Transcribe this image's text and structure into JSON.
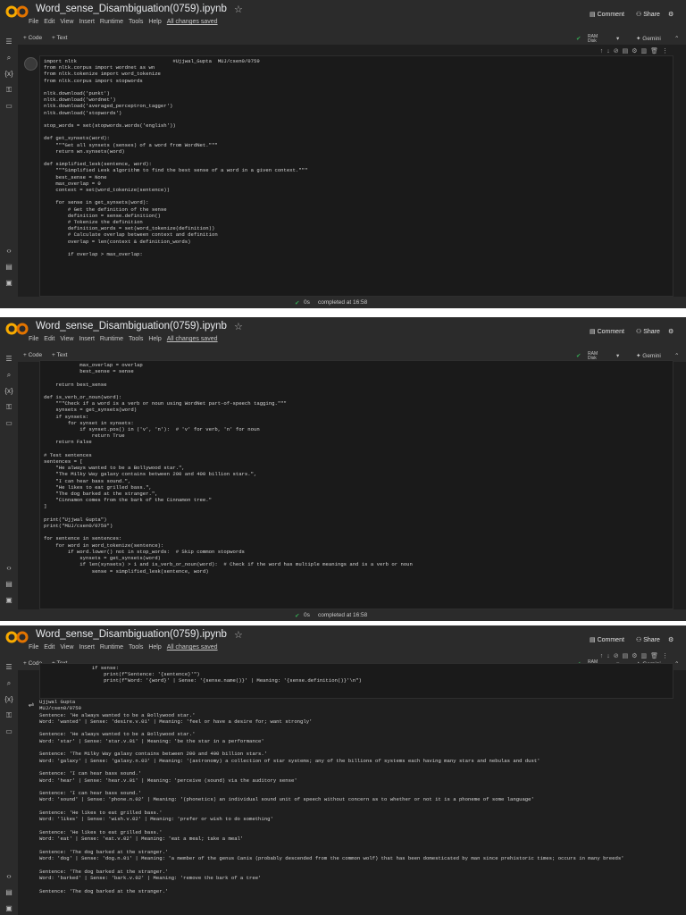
{
  "notebook": {
    "title": "Word_sense_Disambiguation(0759).ipynb",
    "menus": [
      "File",
      "Edit",
      "View",
      "Insert",
      "Runtime",
      "Tools",
      "Help"
    ],
    "saved_status": "All changes saved",
    "comment_label": "Comment",
    "share_label": "Share",
    "toolbar_code": "+ Code",
    "toolbar_text": "+ Text",
    "ram_label": "RAM",
    "disk_label": "Disk",
    "gemini_label": "Gemini",
    "status_time": "0s",
    "status_text": "completed at 16:58"
  },
  "cells": {
    "cell1_code": "import nltk                                #Ujjwal_Gupta  MUJ/csen0/0759\nfrom nltk.corpus import wordnet as wn\nfrom nltk.tokenize import word_tokenize\nfrom nltk.corpus import stopwords\n\nnltk.download('punkt')\nnltk.download('wordnet')\nnltk.download('averaged_perceptron_tagger')\nnltk.download('stopwords')\n\nstop_words = set(stopwords.words('english'))\n\ndef get_synsets(word):\n    \"\"\"Get all synsets (senses) of a word from WordNet.\"\"\"\n    return wn.synsets(word)\n\ndef simplified_lesk(sentence, word):\n    \"\"\"Simplified Lesk algorithm to find the best sense of a word in a given context.\"\"\"\n    best_sense = None\n    max_overlap = 0\n    context = set(word_tokenize(sentence))\n\n    for sense in get_synsets(word):\n        # Get the definition of the sense\n        definition = sense.definition()\n        # Tokenize the definition\n        definition_words = set(word_tokenize(definition))\n        # Calculate overlap between context and definition\n        overlap = len(context & definition_words)\n\n        if overlap > max_overlap:",
    "cell2_code": "            max_overlap = overlap\n            best_sense = sense\n\n    return best_sense\n\ndef is_verb_or_noun(word):\n    \"\"\"Check if a word is a verb or noun using WordNet part-of-speech tagging.\"\"\"\n    synsets = get_synsets(word)\n    if synsets:\n        for synset in synsets:\n            if synset.pos() in ('v', 'n'):  # 'v' for verb, 'n' for noun\n                return True\n    return False\n\n# Test sentences\nsentences = [\n    \"He always wanted to be a Bollywood star.\",\n    \"The Milky Way galaxy contains between 200 and 400 billion stars.\",\n    \"I can hear bass sound.\",\n    \"He likes to eat grilled bass.\",\n    \"The dog barked at the stranger.\",\n    \"Cinnamon comes from the bark of the Cinnamon tree.\"\n]\n\nprint(\"Ujjwal Gupta\")\nprint(\"MUJ/csen0/0759\")\n\nfor sentence in sentences:\n    for word in word_tokenize(sentence):\n        if word.lower() not in stop_words:  # Skip common stopwords\n            synsets = get_synsets(word)\n            if len(synsets) > 1 and is_verb_or_noun(word):  # Check if the word has multiple meanings and is a verb or noun\n                sense = simplified_lesk(sentence, word)",
    "cell3_code": "                if sense:\n                    print(f\"Sentence: '{sentence}'\")\n                    print(f\"Word: '{word}' | Sense: '{sense.name()}' | Meaning: '{sense.definition()}'\\n\")",
    "output_text": "Ujjwal Gupta\nMUJ/csen0/0759\nSentence: 'He always wanted to be a Bollywood star.'\nWord: 'wanted' | Sense: 'desire.v.01' | Meaning: 'feel or have a desire for; want strongly'\n\nSentence: 'He always wanted to be a Bollywood star.'\nWord: 'star' | Sense: 'star.v.01' | Meaning: 'be the star in a performance'\n\nSentence: 'The Milky Way galaxy contains between 200 and 400 billion stars.'\nWord: 'galaxy' | Sense: 'galaxy.n.03' | Meaning: '(astronomy) a collection of star systems; any of the billions of systems each having many stars and nebulas and dust'\n\nSentence: 'I can hear bass sound.'\nWord: 'hear' | Sense: 'hear.v.01' | Meaning: 'perceive (sound) via the auditory sense'\n\nSentence: 'I can hear bass sound.'\nWord: 'sound' | Sense: 'phone.n.02' | Meaning: '(phonetics) an individual sound unit of speech without concern as to whether or not it is a phoneme of some language'\n\nSentence: 'He likes to eat grilled bass.'\nWord: 'likes' | Sense: 'wish.v.02' | Meaning: 'prefer or wish to do something'\n\nSentence: 'He likes to eat grilled bass.'\nWord: 'eat' | Sense: 'eat.v.02' | Meaning: 'eat a meal; take a meal'\n\nSentence: 'The dog barked at the stranger.'\nWord: 'dog' | Sense: 'dog.n.01' | Meaning: 'a member of the genus Canis (probably descended from the common wolf) that has been domesticated by man since prehistoric times; occurs in many breeds'\n\nSentence: 'The dog barked at the stranger.'\nWord: 'barked' | Sense: 'bark.v.02' | Meaning: 'remove the bark of a tree'\n\nSentence: 'The dog barked at the stranger.'"
  },
  "icons": {
    "logo": "colab-logo",
    "sidebar": [
      "menu-icon",
      "search-icon",
      "variables-icon",
      "key-icon",
      "folder-icon"
    ],
    "sidebar_bottom": [
      "code-icon",
      "terminal-icon",
      "command-icon"
    ]
  },
  "colors": {
    "accent_green": "#34a853",
    "logo_orange": "#f9ab00"
  }
}
